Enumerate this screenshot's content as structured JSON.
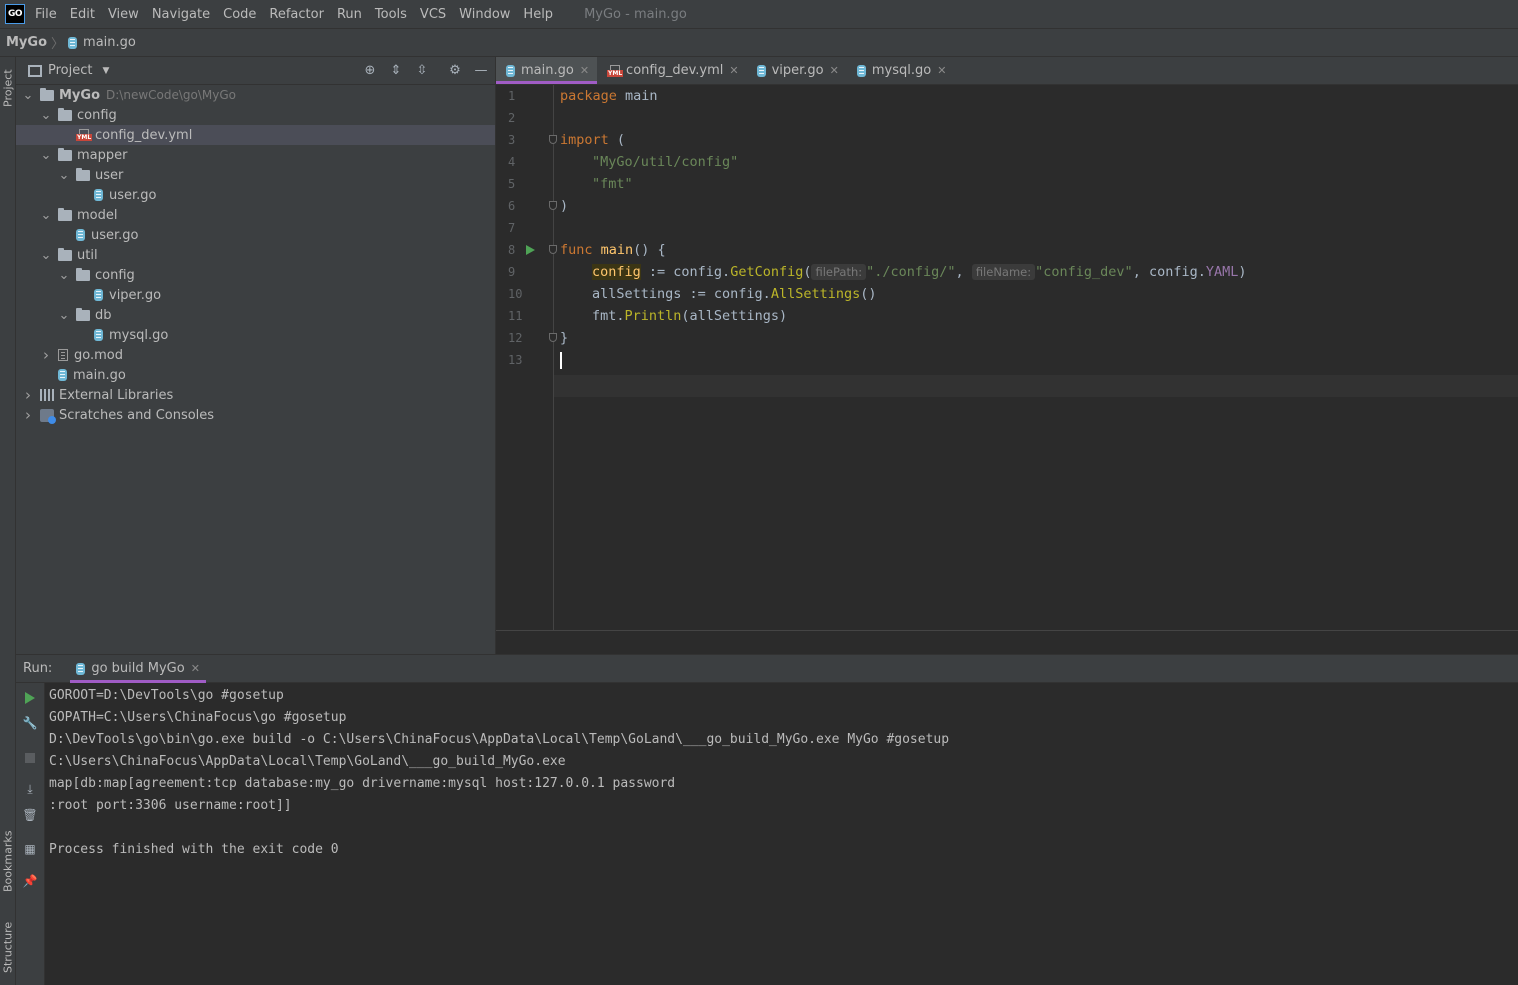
{
  "app": {
    "logo_text": "GO",
    "window_title": "MyGo - main.go",
    "menu": [
      "File",
      "Edit",
      "View",
      "Navigate",
      "Code",
      "Refactor",
      "Run",
      "Tools",
      "VCS",
      "Window",
      "Help"
    ]
  },
  "breadcrumb": {
    "project": "MyGo",
    "separator": "〉",
    "file": "main.go"
  },
  "side_tabs": {
    "project": "Project",
    "bookmarks": "Bookmarks",
    "structure": "Structure"
  },
  "project_panel": {
    "title": "Project",
    "tree": [
      {
        "label": "MyGo",
        "path": "D:\\newCode\\go\\MyGo",
        "type": "folder",
        "depth": 0,
        "expanded": true,
        "bold": true
      },
      {
        "label": "config",
        "type": "folder",
        "depth": 1,
        "expanded": true
      },
      {
        "label": "config_dev.yml",
        "type": "yml",
        "depth": 2,
        "selected": true
      },
      {
        "label": "mapper",
        "type": "folder",
        "depth": 1,
        "expanded": true
      },
      {
        "label": "user",
        "type": "folder",
        "depth": 2,
        "expanded": true
      },
      {
        "label": "user.go",
        "type": "go",
        "depth": 3
      },
      {
        "label": "model",
        "type": "folder",
        "depth": 1,
        "expanded": true
      },
      {
        "label": "user.go",
        "type": "go",
        "depth": 2
      },
      {
        "label": "util",
        "type": "folder",
        "depth": 1,
        "expanded": true
      },
      {
        "label": "config",
        "type": "folder",
        "depth": 2,
        "expanded": true
      },
      {
        "label": "viper.go",
        "type": "go",
        "depth": 3
      },
      {
        "label": "db",
        "type": "folder",
        "depth": 2,
        "expanded": true
      },
      {
        "label": "mysql.go",
        "type": "go",
        "depth": 3
      },
      {
        "label": "go.mod",
        "type": "mod",
        "depth": 1,
        "expanded": false
      },
      {
        "label": "main.go",
        "type": "go",
        "depth": 1
      },
      {
        "label": "External Libraries",
        "type": "lib",
        "depth": 0,
        "expanded": false
      },
      {
        "label": "Scratches and Consoles",
        "type": "scratch",
        "depth": 0,
        "expanded": false
      }
    ]
  },
  "editor": {
    "tabs": [
      {
        "label": "main.go",
        "type": "go",
        "active": true
      },
      {
        "label": "config_dev.yml",
        "type": "yml",
        "active": false
      },
      {
        "label": "viper.go",
        "type": "go",
        "active": false
      },
      {
        "label": "mysql.go",
        "type": "go",
        "active": false
      }
    ],
    "line_numbers": [
      "1",
      "2",
      "3",
      "4",
      "5",
      "6",
      "7",
      "8",
      "9",
      "10",
      "11",
      "12",
      "13"
    ],
    "code": {
      "l1_kw": "package",
      "l1_name": " main",
      "l3_kw": "import",
      "l3_rest": " (",
      "l4": "\"MyGo/util/config\"",
      "l5": "\"fmt\"",
      "l6": ")",
      "l8_kw": "func",
      "l8_fn": " main",
      "l8_rest": "() {",
      "l9_var": "config",
      "l9_op": " := config.",
      "l9_fn": "GetConfig",
      "l9_paren": "(",
      "l9_hint1": "filePath:",
      "l9_arg1": "\"./config/\"",
      "l9_comma": ", ",
      "l9_hint2": "fileName:",
      "l9_arg2": "\"config_dev\"",
      "l9_tail1": ", config.",
      "l9_const": "YAML",
      "l9_tail2": ")",
      "l10_a": "allSettings := config.",
      "l10_fn": "AllSettings",
      "l10_b": "()",
      "l11_a": "fmt.",
      "l11_fn": "Println",
      "l11_b": "(allSettings)",
      "l12": "}"
    }
  },
  "run_panel": {
    "label": "Run:",
    "tab": "go build MyGo",
    "console": [
      "GOROOT=D:\\DevTools\\go #gosetup",
      "GOPATH=C:\\Users\\ChinaFocus\\go #gosetup",
      "D:\\DevTools\\go\\bin\\go.exe build -o C:\\Users\\ChinaFocus\\AppData\\Local\\Temp\\GoLand\\___go_build_MyGo.exe MyGo #gosetup",
      "C:\\Users\\ChinaFocus\\AppData\\Local\\Temp\\GoLand\\___go_build_MyGo.exe",
      "map[db:map[agreement:tcp database:my_go drivername:mysql host:127.0.0.1 password",
      ":root port:3306 username:root]]",
      "",
      "Process finished with the exit code 0"
    ]
  },
  "colors": {
    "accent": "#a05cc5",
    "run_green": "#4fa356",
    "background": "#2b2b2b",
    "panel": "#3c3f41"
  }
}
